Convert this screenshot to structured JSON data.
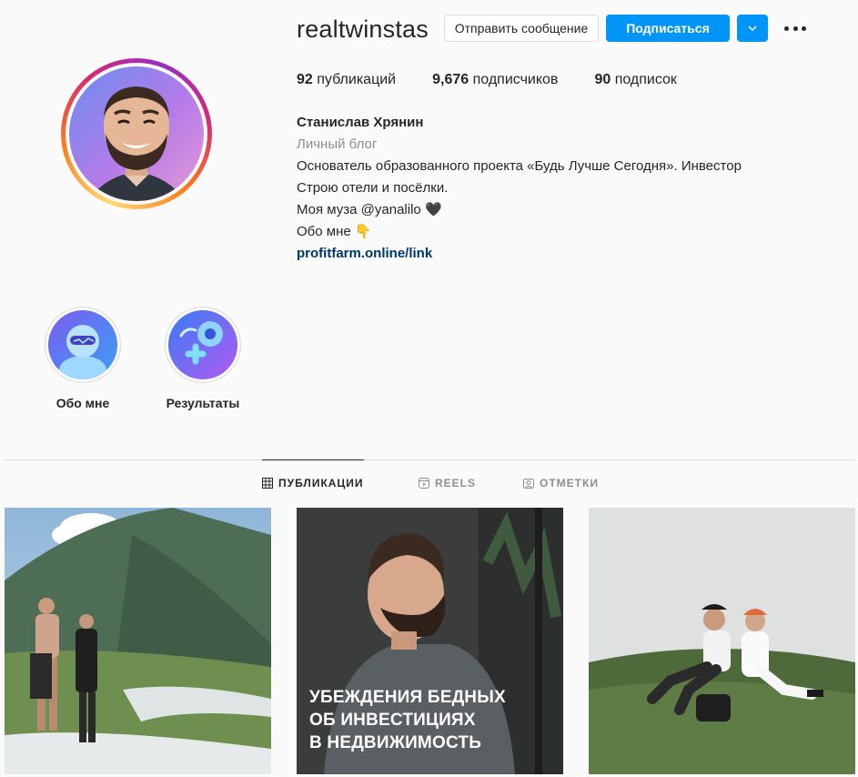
{
  "profile": {
    "username": "realtwinstas",
    "buttons": {
      "message": "Отправить сообщение",
      "follow": "Подписаться"
    },
    "stats": {
      "posts_count": "92",
      "posts_label": "публикаций",
      "followers_count": "9,676",
      "followers_label": "подписчиков",
      "following_count": "90",
      "following_label": "подписок"
    },
    "bio": {
      "name": "Станислав Хрянин",
      "category": "Личный блог",
      "line1": "Основатель образованного проекта «Будь Лучше Сегодня». Инвестор",
      "line2": "Строю отели и посёлки.",
      "line3_prefix": "Моя муза ",
      "line3_mention": "@yanalilo",
      "line3_emoji": "🖤",
      "line4": "Обо мне 👇",
      "link": "profitfarm.online/link"
    }
  },
  "highlights": [
    {
      "label": "Обо мне"
    },
    {
      "label": "Результаты"
    }
  ],
  "tabs": [
    {
      "label": "ПУБЛИКАЦИИ",
      "icon": "grid-icon",
      "active": true
    },
    {
      "label": "REELS",
      "icon": "reels-icon",
      "active": false
    },
    {
      "label": "ОТМЕТКИ",
      "icon": "tagged-icon",
      "active": false
    }
  ],
  "posts": [
    {
      "caption": ""
    },
    {
      "caption_line1": "УБЕЖДЕНИЯ БЕДНЫХ",
      "caption_line2": "ОБ ИНВЕСТИЦИЯХ",
      "caption_line3": "В НЕДВИЖИМОСТЬ"
    },
    {
      "caption": ""
    }
  ],
  "colors": {
    "accent": "#0095f6",
    "link": "#00376b",
    "muted": "#8e8e8e",
    "text": "#262626"
  }
}
